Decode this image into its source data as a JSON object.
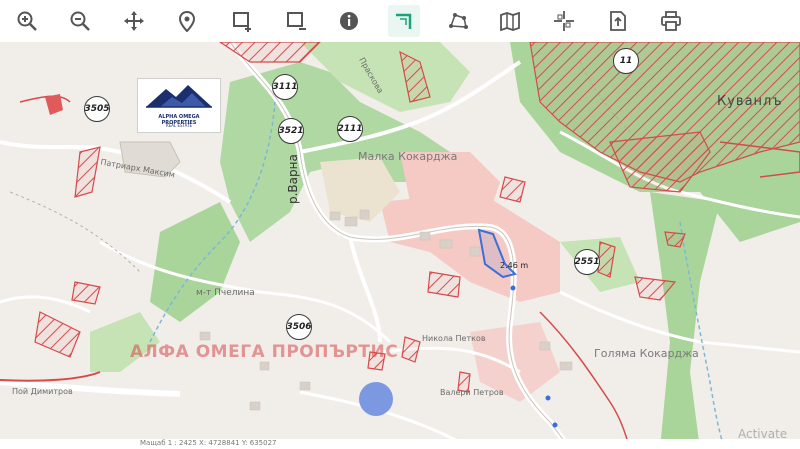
{
  "toolbar": {
    "tools": [
      {
        "name": "zoom-in-icon",
        "active": false
      },
      {
        "name": "zoom-out-icon",
        "active": false
      },
      {
        "name": "pan-icon",
        "active": false
      },
      {
        "name": "location-pin-icon",
        "active": false
      },
      {
        "name": "add-rectangle-icon",
        "active": false
      },
      {
        "name": "remove-rectangle-icon",
        "active": false
      },
      {
        "name": "info-icon",
        "active": false
      },
      {
        "name": "measure-distance-icon",
        "active": true
      },
      {
        "name": "measure-area-icon",
        "active": false
      },
      {
        "name": "map-layers-icon",
        "active": false
      },
      {
        "name": "coordinates-icon",
        "active": false
      },
      {
        "name": "export-icon",
        "active": false
      },
      {
        "name": "print-icon",
        "active": false
      }
    ],
    "active_color": "#1aa37a",
    "icon_color": "#555555"
  },
  "map": {
    "place_labels": {
      "malka_kokardzha": "Малка Кокарджа",
      "kuvanlak": "Куванлъ",
      "golyama_kokardzha": "Голяма Кокарджа",
      "varna_river": "р.Варна",
      "patriarh_maksim": "Патриарх Максим",
      "m_pchelina": "м-т Пчелина",
      "nikola_petkov": "Никола Петков",
      "valeri_petrov": "Валери Петров",
      "poy_dimitrov": "Пой Димитров",
      "praskova": "Праскова"
    },
    "parcel_badges": [
      "3111",
      "3505",
      "3521",
      "2111",
      "11",
      "2551",
      "3506"
    ],
    "measurement_label": "2.46 m",
    "watermark": "АЛФА ОМЕГА ПРОПЪРТИС",
    "logo": {
      "line1": "ALPHA OMEGA PROPERTIES",
      "line2": "REAL ESTATE"
    },
    "colors": {
      "forest": "#a9d59a",
      "forest_light": "#c5e3b4",
      "residential": "#f1eeea",
      "town": "#f5c9c4",
      "hatch": "#d64a4a",
      "selection": "#3b6fd8",
      "position_dot": "#6f8ee0"
    }
  },
  "statusbar": {
    "text": "Мащаб 1 : 2425   X: 4728841   Y: 635027"
  },
  "overlay": {
    "activate_text": "Activate"
  }
}
